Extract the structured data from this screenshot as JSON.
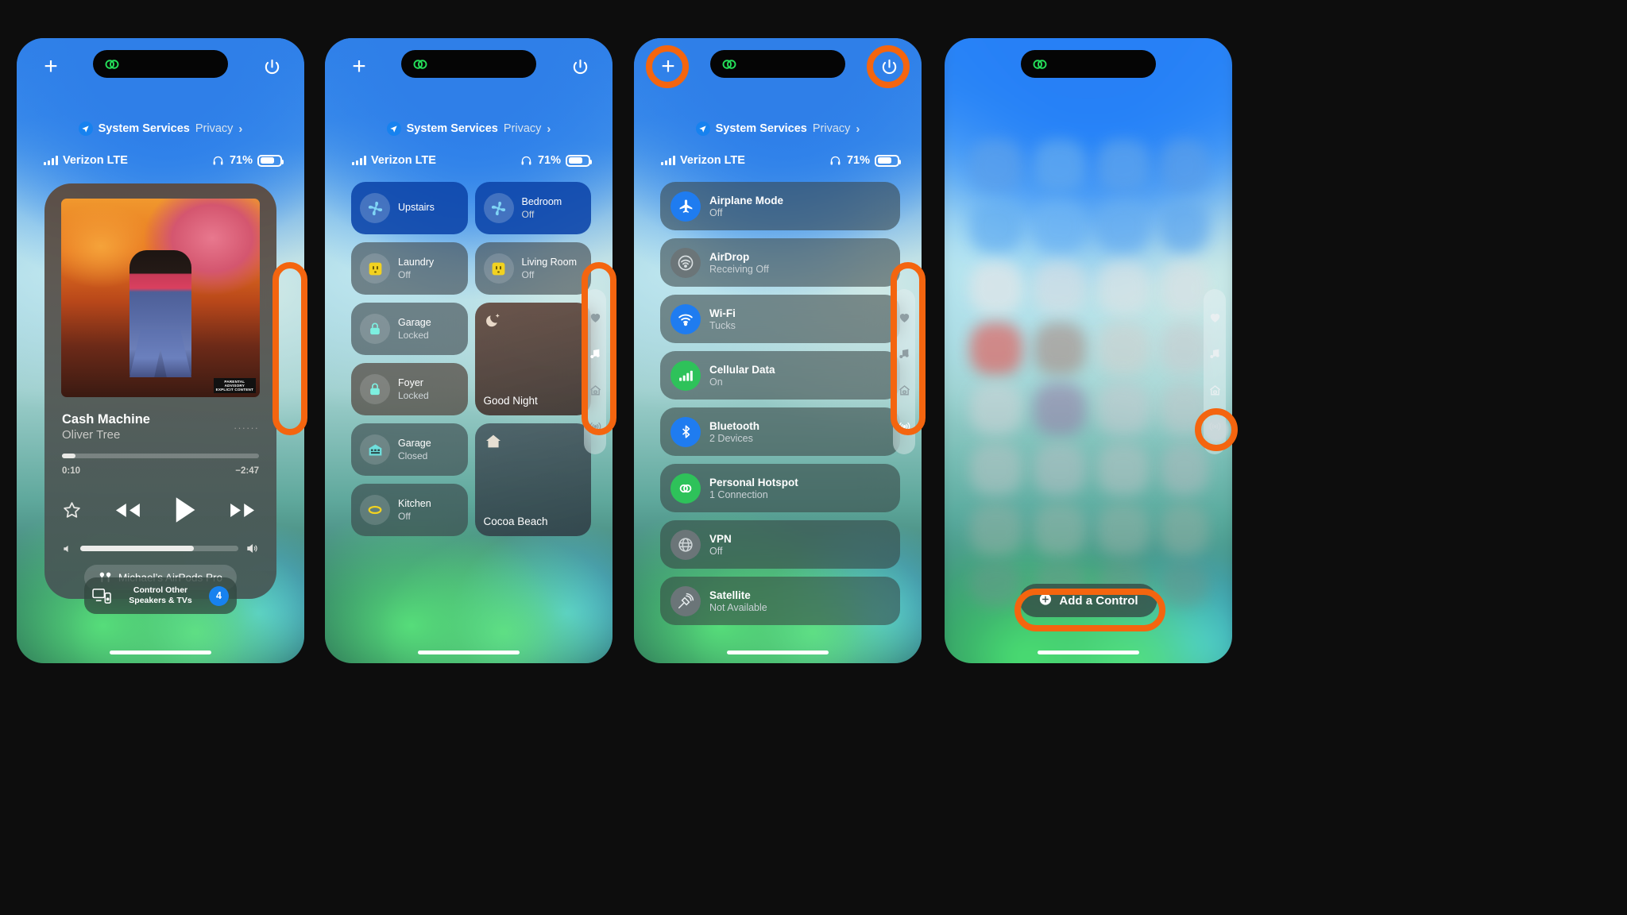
{
  "status": {
    "carrier": "Verizon LTE",
    "battery_percent": "71%",
    "privacy_label": "System Services",
    "privacy_sub": "Privacy",
    "chevron": "›"
  },
  "panel1": {
    "now_playing": {
      "title": "Cash Machine",
      "artist": "Oliver Tree",
      "elapsed": "0:10",
      "remaining": "−2:47",
      "meta_dots": "······",
      "parental_line1": "PARENTAL",
      "parental_line2": "ADVISORY",
      "parental_line3": "EXPLICIT CONTENT",
      "output_device": "Michael’s AirPods Pro",
      "star_icon": "star-icon",
      "rewind_icon": "rewind-icon",
      "play_icon": "play-icon",
      "forward_icon": "fast-forward-icon"
    },
    "speakers": {
      "line1": "Control Other",
      "line2": "Speakers & TVs",
      "count": "4"
    }
  },
  "panel2": {
    "tiles": [
      {
        "name": "Upstairs",
        "state": "",
        "icon": "fan-icon",
        "style": "on"
      },
      {
        "name": "Bedroom",
        "state": "Off",
        "icon": "fan-icon",
        "style": "on"
      },
      {
        "name": "Laundry",
        "state": "Off",
        "icon": "outlet-icon",
        "style": "cool"
      },
      {
        "name": "Living Room",
        "state": "Off",
        "icon": "outlet-icon",
        "style": "cool"
      },
      {
        "name": "Garage",
        "state": "Locked",
        "icon": "lock-icon",
        "style": "cool"
      },
      {
        "name": "Foyer",
        "state": "Locked",
        "icon": "lock-icon",
        "style": "warm"
      },
      {
        "name": "Garage",
        "state": "Closed",
        "icon": "garage-icon",
        "style": "cool"
      },
      {
        "name": "Kitchen",
        "state": "Off",
        "icon": "light-icon",
        "style": "cool"
      }
    ],
    "scenes": [
      {
        "name": "Good Night",
        "icon": "moon-stars-icon"
      },
      {
        "name": "Cocoa Beach",
        "icon": "home-icon"
      }
    ]
  },
  "panel3": {
    "rows": [
      {
        "name": "Airplane Mode",
        "state": "Off",
        "icon": "airplane-icon",
        "color": "#1f7cf0"
      },
      {
        "name": "AirDrop",
        "state": "Receiving Off",
        "icon": "airdrop-icon",
        "color": "#6b7578"
      },
      {
        "name": "Wi-Fi",
        "state": "Tucks",
        "icon": "wifi-icon",
        "color": "#1f7cf0"
      },
      {
        "name": "Cellular Data",
        "state": "On",
        "icon": "cellular-icon",
        "color": "#2ec25a"
      },
      {
        "name": "Bluetooth",
        "state": "2 Devices",
        "icon": "bluetooth-icon",
        "color": "#1f7cf0"
      },
      {
        "name": "Personal Hotspot",
        "state": "1 Connection",
        "icon": "hotspot-icon",
        "color": "#2ec25a"
      },
      {
        "name": "VPN",
        "state": "Off",
        "icon": "vpn-icon",
        "color": "#6b7578"
      },
      {
        "name": "Satellite",
        "state": "Not Available",
        "icon": "satellite-icon",
        "color": "#6b7578"
      }
    ]
  },
  "panel4": {
    "add_control": "Add a Control",
    "add_icon": "plus-circle-icon"
  },
  "rail": {
    "items": [
      {
        "icon": "heart-icon",
        "name": "favorites-page"
      },
      {
        "icon": "music-note-icon",
        "name": "media-page"
      },
      {
        "icon": "home-icon",
        "name": "home-page"
      },
      {
        "icon": "broadcast-icon",
        "name": "connectivity-page"
      }
    ]
  },
  "topbar": {
    "plus": "+",
    "plus_icon": "plus-icon",
    "power_icon": "power-icon",
    "island_icon": "link-icon"
  },
  "colors": {
    "annotation": "#f4650f",
    "accent_blue": "#1f7cf0",
    "accent_green": "#2ec25a"
  }
}
